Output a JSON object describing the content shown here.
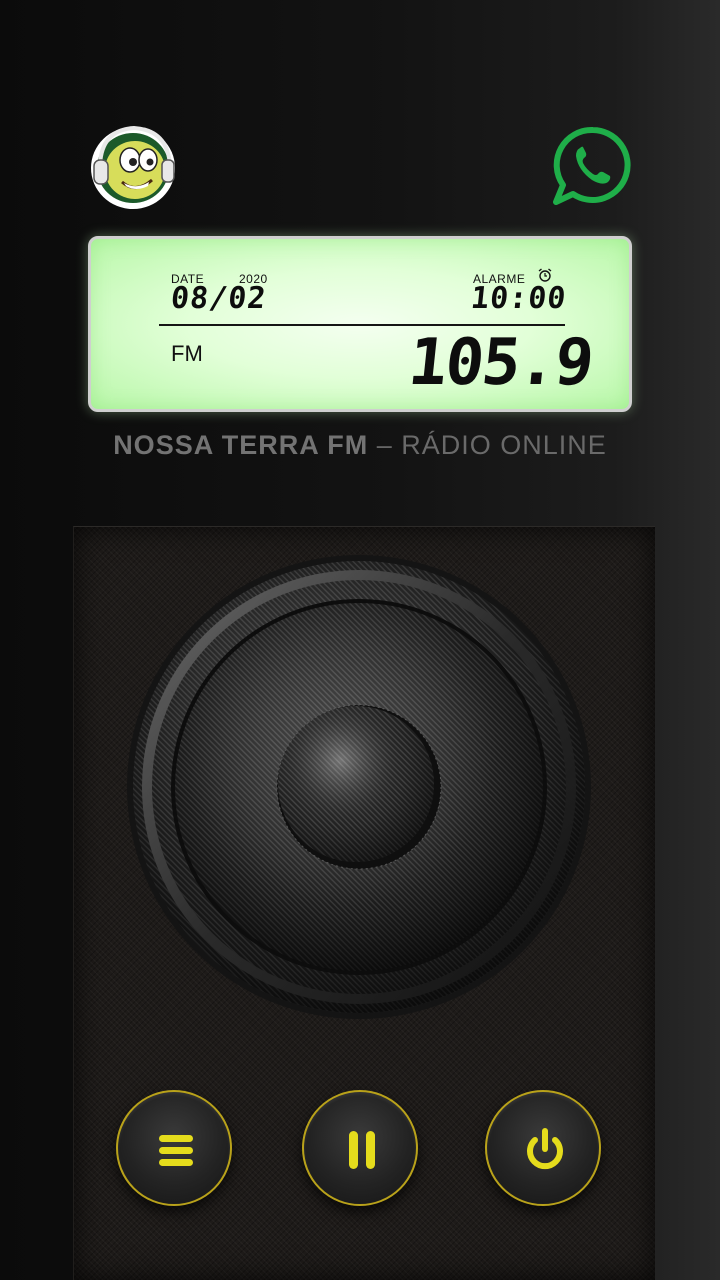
{
  "header": {
    "logo_icon": "mascot-with-headphones-icon",
    "whatsapp_icon": "whatsapp-icon",
    "colors": {
      "whatsapp": "#1fae49"
    }
  },
  "display": {
    "date_label": "DATE",
    "year": "2020",
    "date": "08/02",
    "alarm_label": "ALARME",
    "alarm_icon": "alarm-clock-icon",
    "alarm_time": "10:00",
    "band": "FM",
    "frequency": "105.9",
    "colors": {
      "backlight": "#c8f9b9",
      "digits": "#0d0d0d"
    }
  },
  "station": {
    "name": "NOSSA TERRA FM",
    "separator": "–",
    "subtitle": "RÁDIO ONLINE"
  },
  "controls": {
    "menu_icon": "menu-icon",
    "pause_icon": "pause-icon",
    "power_icon": "power-icon",
    "colors": {
      "accent": "#e5dc1c",
      "ring": "#b9a21a"
    }
  }
}
